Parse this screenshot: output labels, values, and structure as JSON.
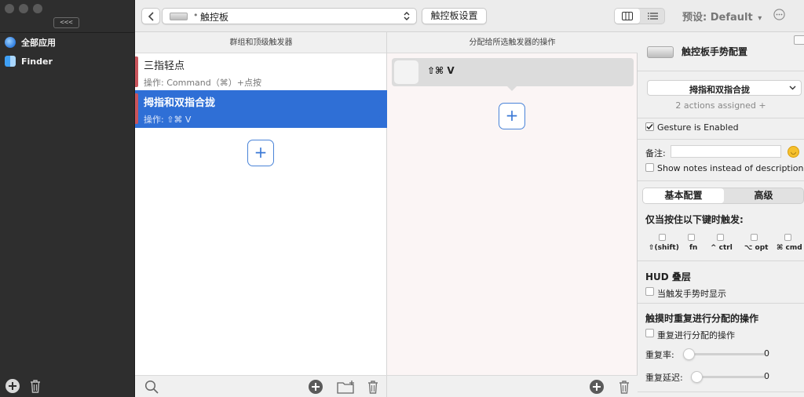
{
  "sidebar": {
    "collapse_label": "<<<",
    "items": [
      {
        "label": "全部应用",
        "icon": "globe-icon"
      },
      {
        "label": "Finder",
        "icon": "finder-icon"
      }
    ],
    "footer": {
      "add_icon": "plus-circle-icon",
      "delete_icon": "trash-icon"
    }
  },
  "toolbar": {
    "back_icon": "chevron-left-icon",
    "device_selector": "触控板",
    "device_selector_prefix": "•",
    "settings_button": "触控板设置",
    "preset_label": "预设: Default",
    "preset_caret": "▾",
    "more_icon": "ellipsis-circle-icon"
  },
  "columns": {
    "left_header": "群组和顶级触发器",
    "middle_header": "分配给所选触发器的操作"
  },
  "triggers": [
    {
      "title": "三指轻点",
      "subtitle": "操作: Command（⌘）+点按",
      "selected": false
    },
    {
      "title": "拇指和双指合拢",
      "subtitle": "操作: ⇧⌘ V",
      "selected": true
    }
  ],
  "actions": [
    {
      "label": "⇧⌘ V"
    }
  ],
  "add_symbol": "+",
  "right_panel": {
    "title": "触控板手势配置",
    "gesture_dropdown": "拇指和双指合拢",
    "actions_assigned": "2 actions assigned +",
    "gesture_enabled": "Gesture is Enabled",
    "notes_label": "备注:",
    "notes_value": "",
    "show_notes_label": "Show notes instead of description",
    "tabs": [
      "基本配置",
      "高级"
    ],
    "modifier_heading": "仅当按住以下键时触发:",
    "modifiers": [
      "⇧(shift)",
      "fn",
      "^ ctrl",
      "⌥ opt",
      "⌘ cmd"
    ],
    "hud_heading": "HUD 叠层",
    "hud_option": "当触发手势时显示",
    "repeat_heading": "触摸时重复进行分配的操作",
    "repeat_option": "重复进行分配的操作",
    "repeat_rate_label": "重复率:",
    "repeat_rate_value": "0",
    "repeat_delay_label": "重复延迟:",
    "repeat_delay_value": "0"
  },
  "colors": {
    "selected_row": "#2f6fd6",
    "trigger_marker": "#c9555c",
    "accent": "#3a78d6",
    "sidebar_bg": "#2e2e2e"
  }
}
